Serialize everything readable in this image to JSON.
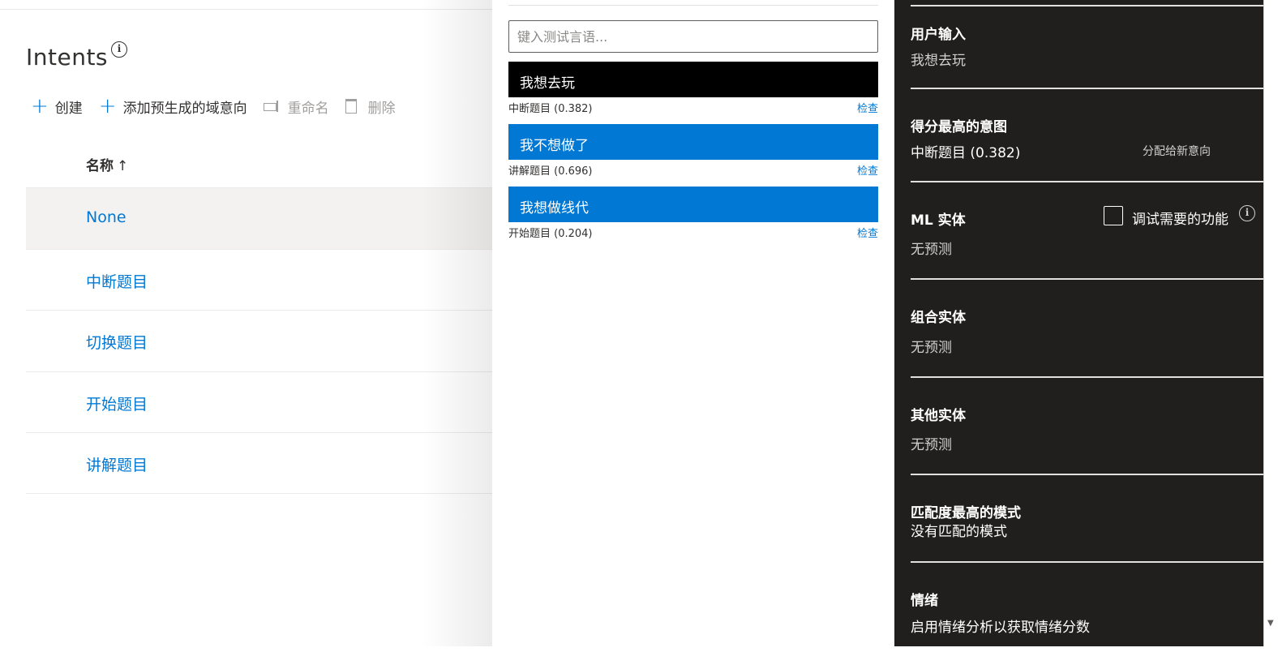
{
  "left": {
    "title": "Intents",
    "commands": {
      "create": "创建",
      "add_prebuilt": "添加预生成的域意向",
      "rename": "重命名",
      "delete": "删除"
    },
    "column_header": "名称",
    "sort_indicator": "↑",
    "rows": [
      {
        "name": "None"
      },
      {
        "name": "中断题目"
      },
      {
        "name": "切换题目"
      },
      {
        "name": "开始题目"
      },
      {
        "name": "讲解题目"
      }
    ]
  },
  "test": {
    "placeholder": "键入测试言语...",
    "utterances": [
      {
        "text": "我想去玩",
        "prediction": "中断题目 (0.382)",
        "inspect": "检查"
      },
      {
        "text": "我不想做了",
        "prediction": "讲解题目 (0.696)",
        "inspect": "检查"
      },
      {
        "text": "我想做线代",
        "prediction": "开始题目 (0.204)",
        "inspect": "检查"
      }
    ]
  },
  "inspect_panel": {
    "user_input_title": "用户输入",
    "user_input_value": "我想去玩",
    "top_intent_title": "得分最高的意图",
    "top_intent_value": "中断题目 (0.382)",
    "reassign_label": "分配给新意向",
    "ml_entities_title": "ML 实体",
    "debug_features_label": "调试需要的功能",
    "ml_entities_value": "无预测",
    "composite_title": "组合实体",
    "composite_value": "无预测",
    "other_title": "其他实体",
    "other_value": "无预测",
    "pattern_title": "匹配度最高的模式",
    "pattern_value": "没有匹配的模式",
    "sentiment_title": "情绪",
    "sentiment_value": "启用情绪分析以获取情绪分数"
  },
  "colors": {
    "accent": "#0078d4",
    "dark_panel": "#201f1e",
    "selected_row": "#f3f2f1"
  }
}
